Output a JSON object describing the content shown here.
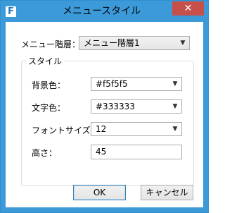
{
  "window": {
    "title": "メニュースタイル",
    "close_glyph": "✕"
  },
  "menu_level": {
    "label": "メニュー階層：",
    "value": "メニュー階層1"
  },
  "style_group": {
    "title": "スタイル",
    "background_color": {
      "label": "背景色：",
      "value": "#f5f5f5"
    },
    "text_color": {
      "label": "文字色：",
      "value": "#333333"
    },
    "font_size": {
      "label": "フォントサイズ：",
      "value": "12"
    },
    "height": {
      "label": "高さ：",
      "value": "45"
    }
  },
  "buttons": {
    "ok": "OK",
    "cancel": "キャンセル"
  },
  "colors": {
    "titlebar": "#3c9ad9",
    "close_button": "#c7504a"
  },
  "icons": {
    "app": "app-f-icon",
    "dropdown": "chevron-down-icon",
    "close": "close-icon"
  }
}
